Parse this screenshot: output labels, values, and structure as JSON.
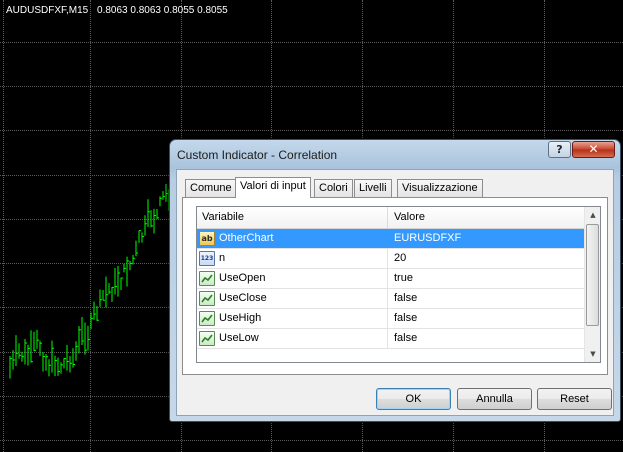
{
  "chart": {
    "header": {
      "symbol_tf": "AUDUSDFXF,M15",
      "ohlc": [
        "0.8063",
        "0.8063",
        "0.8055",
        "0.8055"
      ]
    },
    "colors": {
      "background": "#000000",
      "candles": "#00ff00",
      "grid": "#5b5b5b"
    }
  },
  "dialog": {
    "title": "Custom Indicator - Correlation",
    "help_label": "?",
    "close_label": "✕",
    "tabs": [
      {
        "label": "Comune",
        "active": false
      },
      {
        "label": "Valori di input",
        "active": true
      },
      {
        "label": "Colori",
        "active": false
      },
      {
        "label": "Livelli",
        "active": false
      },
      {
        "label": "Visualizzazione",
        "active": false
      }
    ],
    "table": {
      "col_variable": "Variabile",
      "col_value": "Valore",
      "rows": [
        {
          "icon": "string-icon",
          "icon_text": "ab",
          "name": "OtherChart",
          "value": "EURUSDFXF",
          "selected": true
        },
        {
          "icon": "number-icon",
          "icon_text": "123",
          "name": "n",
          "value": "20",
          "selected": false
        },
        {
          "icon": "bool-icon",
          "name": "UseOpen",
          "value": "true",
          "selected": false
        },
        {
          "icon": "bool-icon",
          "name": "UseClose",
          "value": "false",
          "selected": false
        },
        {
          "icon": "bool-icon",
          "name": "UseHigh",
          "value": "false",
          "selected": false
        },
        {
          "icon": "bool-icon",
          "name": "UseLow",
          "value": "false",
          "selected": false
        }
      ]
    },
    "buttons": {
      "ok": "OK",
      "cancel": "Annulla",
      "reset": "Reset"
    },
    "colors": {
      "selection": "#3399ff",
      "frame": "#b7cde3"
    }
  }
}
